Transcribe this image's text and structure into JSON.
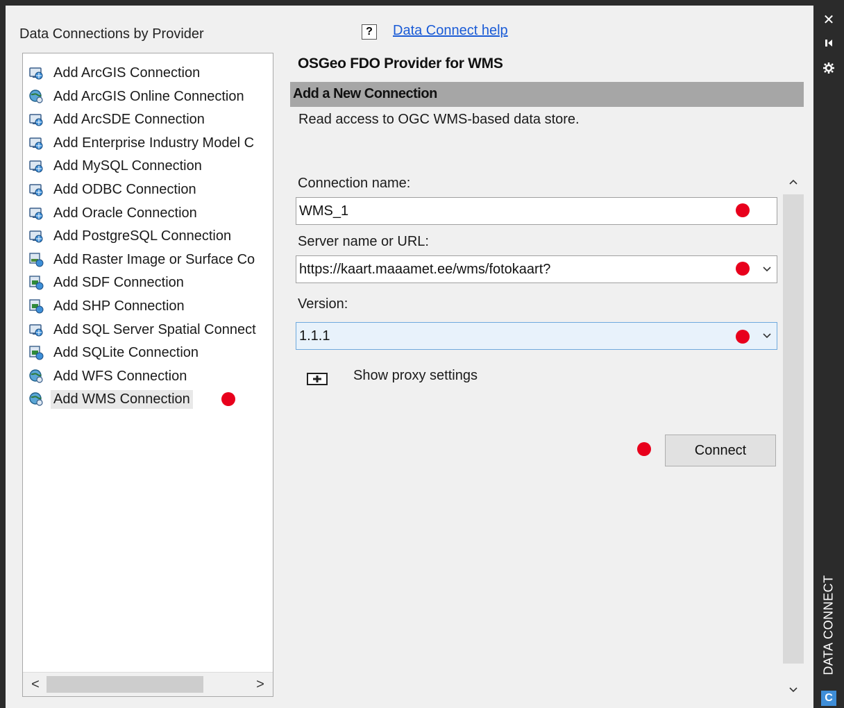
{
  "panel": {
    "section_title": "Data Connections by Provider",
    "help_icon_glyph": "?",
    "help_link": "Data Connect help"
  },
  "providers": {
    "items": [
      {
        "label": "Add ArcGIS Connection",
        "icon": "database-globe-icon"
      },
      {
        "label": "Add ArcGIS Online Connection",
        "icon": "globe-connection-icon"
      },
      {
        "label": "Add ArcSDE Connection",
        "icon": "database-globe-icon"
      },
      {
        "label": "Add Enterprise Industry Model C",
        "icon": "database-globe-icon"
      },
      {
        "label": "Add MySQL Connection",
        "icon": "database-globe-icon"
      },
      {
        "label": "Add ODBC Connection",
        "icon": "database-globe-icon"
      },
      {
        "label": "Add Oracle Connection",
        "icon": "database-globe-icon"
      },
      {
        "label": "Add PostgreSQL Connection",
        "icon": "database-globe-icon"
      },
      {
        "label": "Add Raster Image or Surface Co",
        "icon": "raster-image-icon"
      },
      {
        "label": "Add SDF Connection",
        "icon": "file-data-icon"
      },
      {
        "label": "Add SHP Connection",
        "icon": "file-data-icon"
      },
      {
        "label": "Add SQL Server Spatial Connect",
        "icon": "database-globe-icon"
      },
      {
        "label": "Add SQLite Connection",
        "icon": "file-data-icon"
      },
      {
        "label": "Add WFS Connection",
        "icon": "globe-connection-icon"
      },
      {
        "label": "Add WMS Connection",
        "icon": "globe-connection-icon"
      }
    ],
    "selected": "Add WMS Connection",
    "scroll_left": "<",
    "scroll_right": ">"
  },
  "detail": {
    "provider_title": "OSGeo FDO Provider for WMS",
    "section_header": "Add a New Connection",
    "description": "Read access to OGC WMS-based data store.",
    "connection_name_label": "Connection name:",
    "connection_name_value": "WMS_1",
    "server_label": "Server name or URL:",
    "server_value": "https://kaart.maaamet.ee/wms/fotokaart?",
    "version_label": "Version:",
    "version_value": "1.1.1",
    "proxy_label": "Show proxy settings",
    "connect_button": "Connect"
  },
  "sidebar": {
    "title": "DATA CONNECT",
    "close_glyph": "✕",
    "badge": "C"
  },
  "colors": {
    "accent_link": "#1a5bd6",
    "marker_dot": "#e8001c",
    "header_bar": "#a6a6a6",
    "focus_field": "#e8f2fb"
  }
}
